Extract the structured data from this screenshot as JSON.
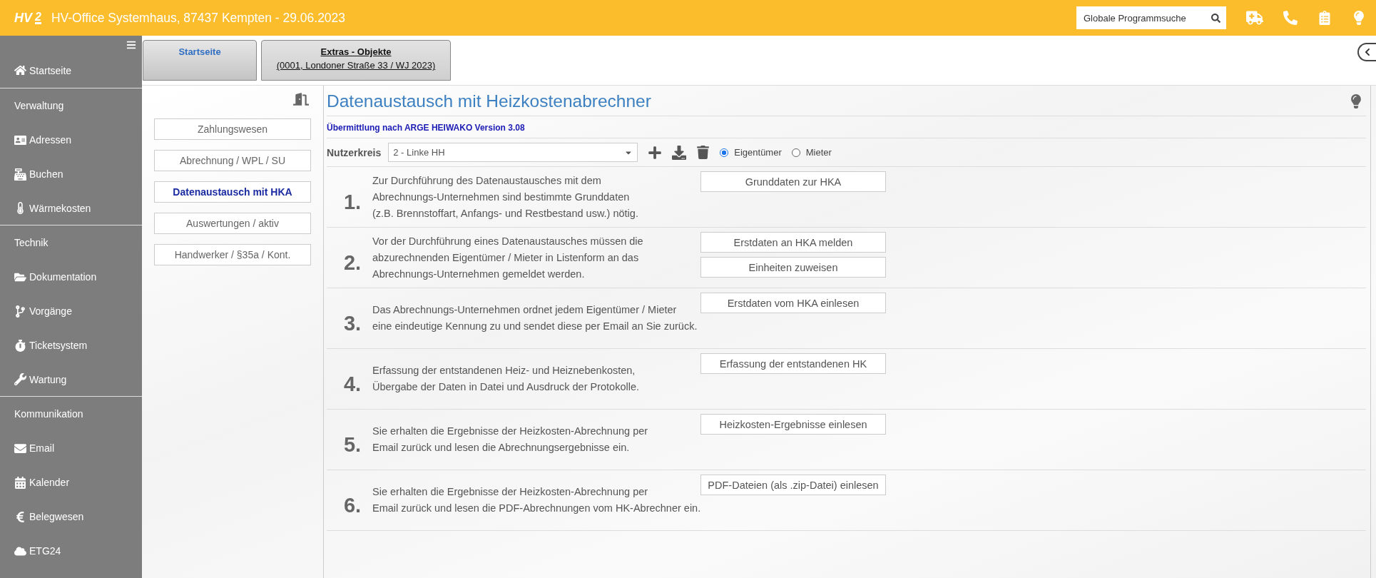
{
  "header": {
    "logo_text": "HV",
    "logo_number": "2",
    "title": "HV-Office Systemhaus, 87437 Kempten - 29.06.2023",
    "search": {
      "placeholder": "Globale Programmsuche"
    }
  },
  "sidebar": {
    "items": [
      {
        "kind": "link",
        "label": "Startseite"
      },
      {
        "kind": "section",
        "label": "Verwaltung"
      },
      {
        "kind": "link",
        "label": "Adressen"
      },
      {
        "kind": "link",
        "label": "Buchen"
      },
      {
        "kind": "link",
        "label": "Wärmekosten"
      },
      {
        "kind": "section",
        "label": "Technik"
      },
      {
        "kind": "link",
        "label": "Dokumentation"
      },
      {
        "kind": "link",
        "label": "Vorgänge"
      },
      {
        "kind": "link",
        "label": "Ticketsystem"
      },
      {
        "kind": "link",
        "label": "Wartung"
      },
      {
        "kind": "section",
        "label": "Kommunikation"
      },
      {
        "kind": "link",
        "label": "Email"
      },
      {
        "kind": "link",
        "label": "Kalender"
      },
      {
        "kind": "link",
        "label": "Belegwesen"
      },
      {
        "kind": "link",
        "label": "ETG24"
      }
    ]
  },
  "tabs": [
    {
      "title": "Startseite",
      "selected": false
    },
    {
      "title": "Extras - Objekte",
      "subtitle": "(0001, Londoner Straße 33 / WJ 2023)",
      "selected": true
    }
  ],
  "left_nav": {
    "items": [
      {
        "label": "Zahlungswesen",
        "selected": false
      },
      {
        "label": "Abrechnung / WPL / SU",
        "selected": false
      },
      {
        "label": "Datenaustausch mit HKA",
        "selected": true
      },
      {
        "label": "Auswertungen / aktiv",
        "selected": false
      },
      {
        "label": "Handwerker / §35a / Kont.",
        "selected": false
      }
    ]
  },
  "main": {
    "title": "Datenaustausch mit Heizkostenabrechner",
    "subtitle": "Übermittlung nach ARGE HEIWAKO Version 3.08",
    "nutzerkreis": {
      "label": "Nutzerkreis",
      "value": "2 - Linke HH"
    },
    "radios": [
      {
        "label": "Eigentümer",
        "selected": true
      },
      {
        "label": "Mieter",
        "selected": false
      }
    ],
    "steps": [
      {
        "number": "1.",
        "lines": [
          "Zur Durchführung des Datenaustausches mit dem",
          "Abrechnungs-Unternehmen sind bestimmte Grunddaten",
          "(z.B. Brennstoffart, Anfangs- und Restbestand usw.) nötig."
        ],
        "buttons": [
          "Grunddaten zur HKA"
        ]
      },
      {
        "number": "2.",
        "lines": [
          "Vor der Durchführung eines Datenaustausches müssen die",
          "abzurechnenden Eigentümer / Mieter in Listenform an das",
          "Abrechnungs-Unternehmen gemeldet werden."
        ],
        "buttons": [
          "Erstdaten an HKA melden",
          "Einheiten zuweisen"
        ]
      },
      {
        "number": "3.",
        "lines": [
          "Das Abrechnungs-Unternehmen ordnet jedem Eigentümer / Mieter",
          "eine eindeutige Kennung zu und sendet diese per Email an Sie zurück."
        ],
        "buttons": [
          "Erstdaten vom HKA einlesen"
        ]
      },
      {
        "number": "4.",
        "lines": [
          "Erfassung der entstandenen Heiz- und Heiznebenkosten,",
          "Übergabe der Daten in Datei und Ausdruck der Protokolle."
        ],
        "buttons": [
          "Erfassung der entstandenen HK"
        ]
      },
      {
        "number": "5.",
        "lines": [
          "Sie erhalten die Ergebnisse der Heizkosten-Abrechnung per",
          "Email zurück und lesen die Abrechnungsergebnisse ein."
        ],
        "buttons": [
          "Heizkosten-Ergebnisse einlesen"
        ]
      },
      {
        "number": "6.",
        "lines": [
          "Sie erhalten die Ergebnisse der Heizkosten-Abrechnung per",
          "Email zurück und lesen die PDF-Abrechnungen vom HK-Abrechner ein."
        ],
        "buttons": [
          "PDF-Dateien (als .zip-Datei) einlesen"
        ]
      }
    ]
  }
}
